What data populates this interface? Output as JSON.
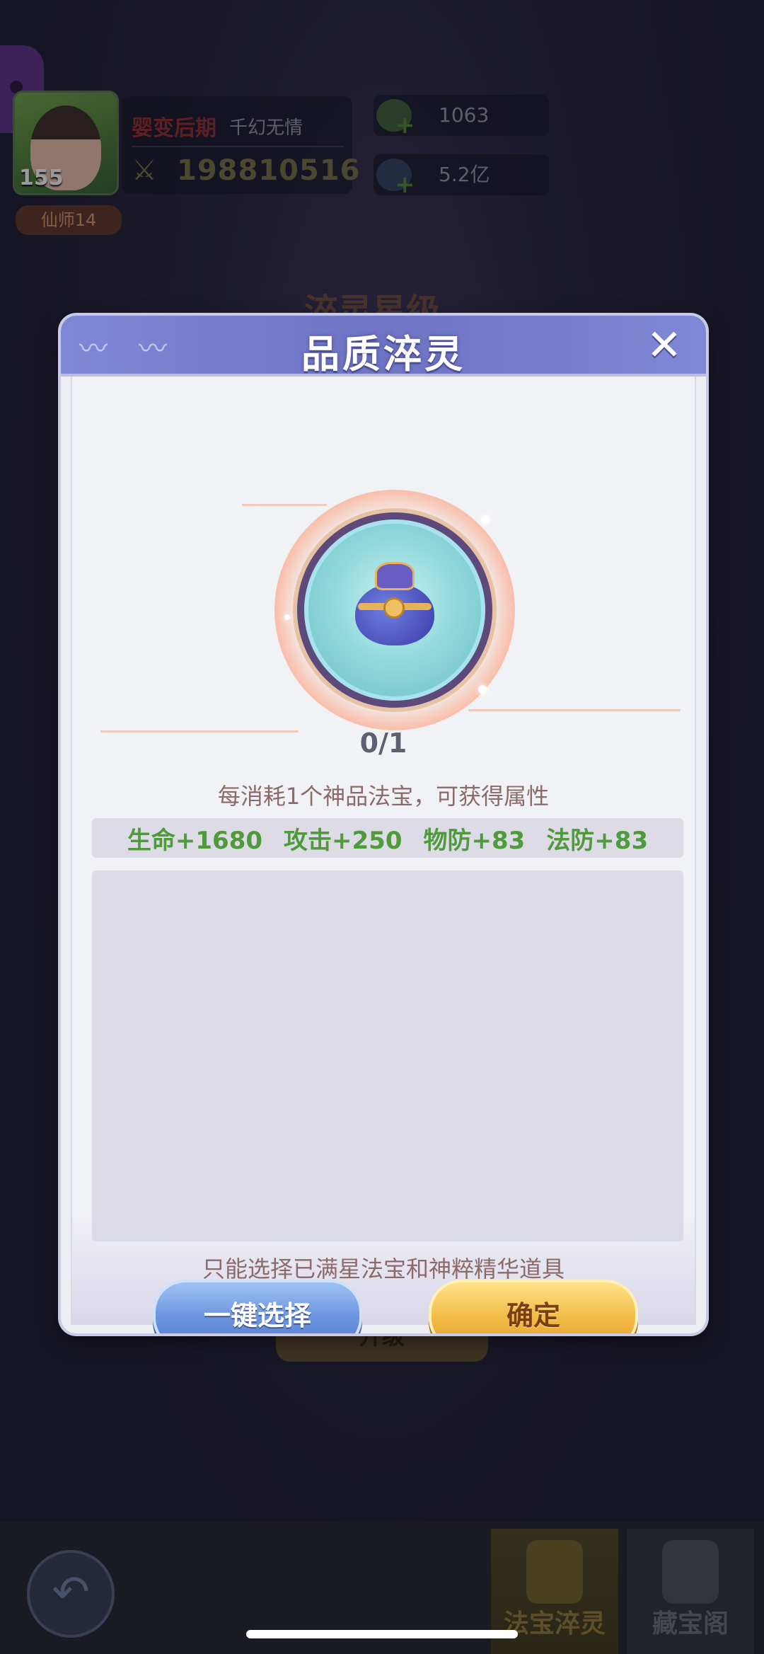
{
  "hud": {
    "level": "155",
    "rank": "仙师14",
    "realm": "婴变后期",
    "name": "千幻无情",
    "power": "198810516",
    "resources": [
      {
        "icon": "green-gem-icon",
        "value": "1063"
      },
      {
        "icon": "blue-crystal-icon",
        "value": "5.2亿"
      }
    ]
  },
  "background": {
    "heading": "淬灵星级",
    "upgrade_button": "升级"
  },
  "modal": {
    "title": "品质淬灵",
    "progress": "0/1",
    "description": "每消耗1个神品法宝，可获得属性",
    "attributes": [
      "生命+1680",
      "攻击+250",
      "物防+83",
      "法防+83"
    ],
    "hint": "只能选择已满星法宝和神粹精华道具",
    "auto_select_label": "一键选择",
    "confirm_label": "确定"
  },
  "nav": {
    "tabs": [
      {
        "label": "法宝淬灵",
        "active": true
      },
      {
        "label": "藏宝阁",
        "active": false
      }
    ]
  },
  "colors": {
    "header": "#7f88d6",
    "attribute_green": "#4f9a3b",
    "button_blue": "#6a93df",
    "button_gold": "#f2bb45"
  }
}
